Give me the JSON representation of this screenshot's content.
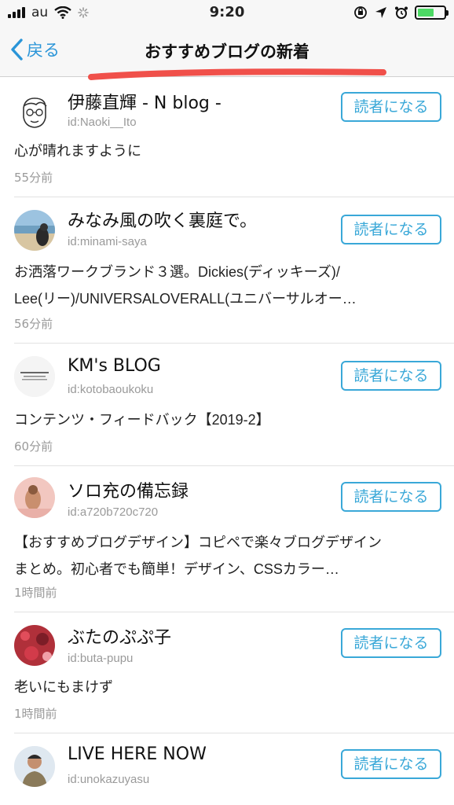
{
  "status_bar": {
    "carrier": "au",
    "time": "9:20"
  },
  "nav": {
    "back_label": "戻る",
    "title": "おすすめブログの新着"
  },
  "follow_label": "読者になる",
  "items": [
    {
      "name": "伊藤直輝 - N blog -",
      "id": "id:Naoki__Ito",
      "entry_line1": "心が晴れますように",
      "entry_line2": "",
      "time": "55分前",
      "avatar": "line-drawing-face"
    },
    {
      "name": "みなみ風の吹く裏庭で。",
      "id": "id:minami-saya",
      "entry_line1": "お洒落ワークブランド３選。Dickies(ディッキーズ)/",
      "entry_line2": "Lee(リー)/UNIVERSALOVERALL(ユニバーサルオー…",
      "time": "56分前",
      "avatar": "beach-photo"
    },
    {
      "name": "KM's BLOG",
      "id": "id:kotobaoukoku",
      "entry_line1": "コンテンツ・フィードバック【2019-2】",
      "entry_line2": "",
      "time": "60分前",
      "avatar": "text-logo"
    },
    {
      "name": "ソロ充の備忘録",
      "id": "id:a720b720c720",
      "entry_line1": "【おすすめブログデザイン】コピペで楽々ブログデザイン",
      "entry_line2": "まとめ。初心者でも簡単！デザイン、CSSカラー…",
      "time": "1時間前",
      "avatar": "pink-photo"
    },
    {
      "name": "ぶたのぷぷ子",
      "id": "id:buta-pupu",
      "entry_line1": "老いにもまけず",
      "entry_line2": "",
      "time": "1時間前",
      "avatar": "red-photo"
    },
    {
      "name": "LIVE HERE NOW",
      "id": "id:unokazuyasu",
      "entry_line1": "",
      "entry_line2": "",
      "time": "",
      "avatar": "person-photo"
    }
  ],
  "colors": {
    "accent": "#3aa8d8",
    "back": "#2a95d8",
    "annotation": "#f0504a"
  }
}
